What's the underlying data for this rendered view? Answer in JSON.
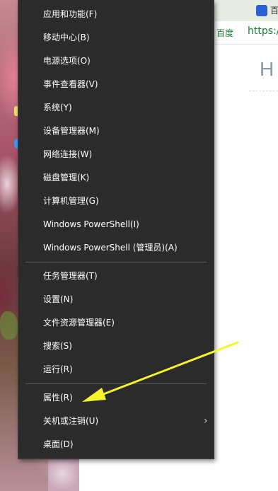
{
  "browser": {
    "tab_title": "百",
    "tab_icon": "baidu-paw-icon",
    "bookmark_label": "百度",
    "url_partial": "https:/",
    "content_heading_partial": "H"
  },
  "menu": {
    "items": [
      {
        "label": "应用和功能(F)"
      },
      {
        "label": "移动中心(B)"
      },
      {
        "label": "电源选项(O)"
      },
      {
        "label": "事件查看器(V)"
      },
      {
        "label": "系统(Y)"
      },
      {
        "label": "设备管理器(M)"
      },
      {
        "label": "网络连接(W)"
      },
      {
        "label": "磁盘管理(K)"
      },
      {
        "label": "计算机管理(G)"
      },
      {
        "label": "Windows PowerShell(I)"
      },
      {
        "label": "Windows PowerShell (管理员)(A)"
      },
      {
        "label": "任务管理器(T)"
      },
      {
        "label": "设置(N)"
      },
      {
        "label": "文件资源管理器(E)"
      },
      {
        "label": "搜索(S)"
      },
      {
        "label": "运行(R)"
      },
      {
        "label": "属性(R)"
      },
      {
        "label": "关机或注销(U)",
        "submenu_icon": "chevron-right-icon"
      },
      {
        "label": "桌面(D)"
      }
    ]
  },
  "colors": {
    "menu_bg": "#2b2b2b",
    "menu_text": "#ffffff",
    "annotation_arrow": "#f5f52a",
    "link_green": "#1a7f3a"
  }
}
